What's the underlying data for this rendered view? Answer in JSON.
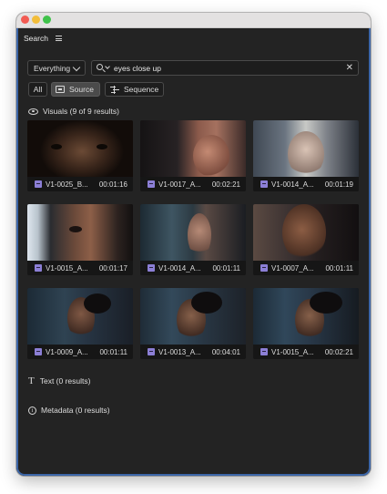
{
  "panel": {
    "title": "Search"
  },
  "search": {
    "scope": "Everything",
    "query": "eyes close up"
  },
  "filters": {
    "all": "All",
    "source": "Source",
    "sequence": "Sequence",
    "active": "Source"
  },
  "sections": {
    "visuals": "Visuals (9 of 9 results)",
    "text": "Text (0 results)",
    "metadata": "Metadata (0 results)"
  },
  "results": [
    {
      "name": "V1-0025_B...",
      "duration": "00:01:16"
    },
    {
      "name": "V1-0017_A...",
      "duration": "00:02:21"
    },
    {
      "name": "V1-0014_A...",
      "duration": "00:01:19"
    },
    {
      "name": "V1-0015_A...",
      "duration": "00:01:17"
    },
    {
      "name": "V1-0014_A...",
      "duration": "00:01:11"
    },
    {
      "name": "V1-0007_A...",
      "duration": "00:01:11"
    },
    {
      "name": "V1-0009_A...",
      "duration": "00:01:11"
    },
    {
      "name": "V1-0013_A...",
      "duration": "00:04:01"
    },
    {
      "name": "V1-0015_A...",
      "duration": "00:02:21"
    }
  ],
  "icons": {
    "menu": "hamburger-icon",
    "scope": "chevron-down-icon",
    "search": "search-icon",
    "clear": "close-icon",
    "source": "source-icon",
    "sequence": "sequence-icon",
    "visuals": "eye-icon",
    "text": "text-icon",
    "metadata": "info-icon",
    "clip": "clip-icon"
  },
  "colors": {
    "accent": "#3c66a8",
    "clip_icon": "#8c7fd6",
    "panel_bg": "#232323"
  }
}
